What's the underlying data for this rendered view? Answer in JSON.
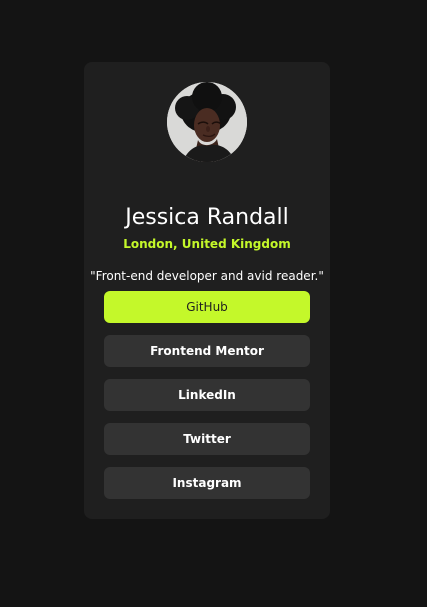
{
  "profile": {
    "name": "Jessica Randall",
    "location": "London, United Kingdom",
    "bio": "\"Front-end developer and avid reader.\""
  },
  "links": [
    {
      "label": "GitHub",
      "active": true
    },
    {
      "label": "Frontend Mentor",
      "active": false
    },
    {
      "label": "LinkedIn",
      "active": false
    },
    {
      "label": "Twitter",
      "active": false
    },
    {
      "label": "Instagram",
      "active": false
    }
  ],
  "colors": {
    "background": "#141414",
    "card": "#1f1f1f",
    "button": "#333333",
    "accent": "#c4f82a",
    "text": "#ffffff"
  }
}
